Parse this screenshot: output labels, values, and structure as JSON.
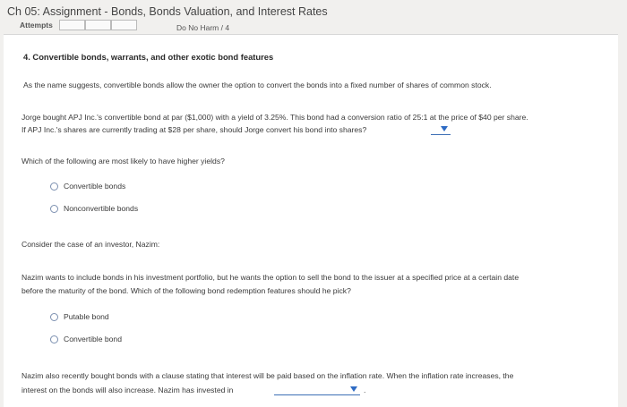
{
  "header": {
    "title": "Ch 05: Assignment - Bonds, Bonds Valuation, and Interest Rates",
    "attempts_label": "Attempts",
    "do_no_harm": "Do No Harm / 4"
  },
  "question": {
    "heading": "4. Convertible bonds, warrants, and other exotic bond features",
    "intro": "As the name suggests, convertible bonds allow the owner the option to convert the bonds into a fixed number of shares of common stock.",
    "jorge_line1": "Jorge bought APJ Inc.'s convertible bond at par ($1,000) with a yield of 3.25%. This bond had a conversion ratio of 25:1 at the price of $40 per share.",
    "jorge_line2": "If APJ Inc.'s shares are currently trading at $28 per share, should Jorge convert his bond into shares?",
    "yield_question": "Which of the following are most likely to have higher yields?",
    "yield_options": [
      "Convertible bonds",
      "Nonconvertible bonds"
    ],
    "nazim_intro": "Consider the case of an investor, Nazim:",
    "nazim_line1": "Nazim wants to include bonds in his investment portfolio, but he wants the option to sell the bond to the issuer at a specified price at a certain date",
    "nazim_line2": "before the maturity of the bond. Which of the following bond redemption features should he pick?",
    "redemption_options": [
      "Putable bond",
      "Convertible bond"
    ],
    "inflation_line1": "Nazim also recently bought bonds with a clause stating that interest will be paid based on the inflation rate. When the inflation rate increases, the",
    "inflation_line2": "interest on the bonds will also increase. Nazim has invested in",
    "inflation_period": "."
  }
}
